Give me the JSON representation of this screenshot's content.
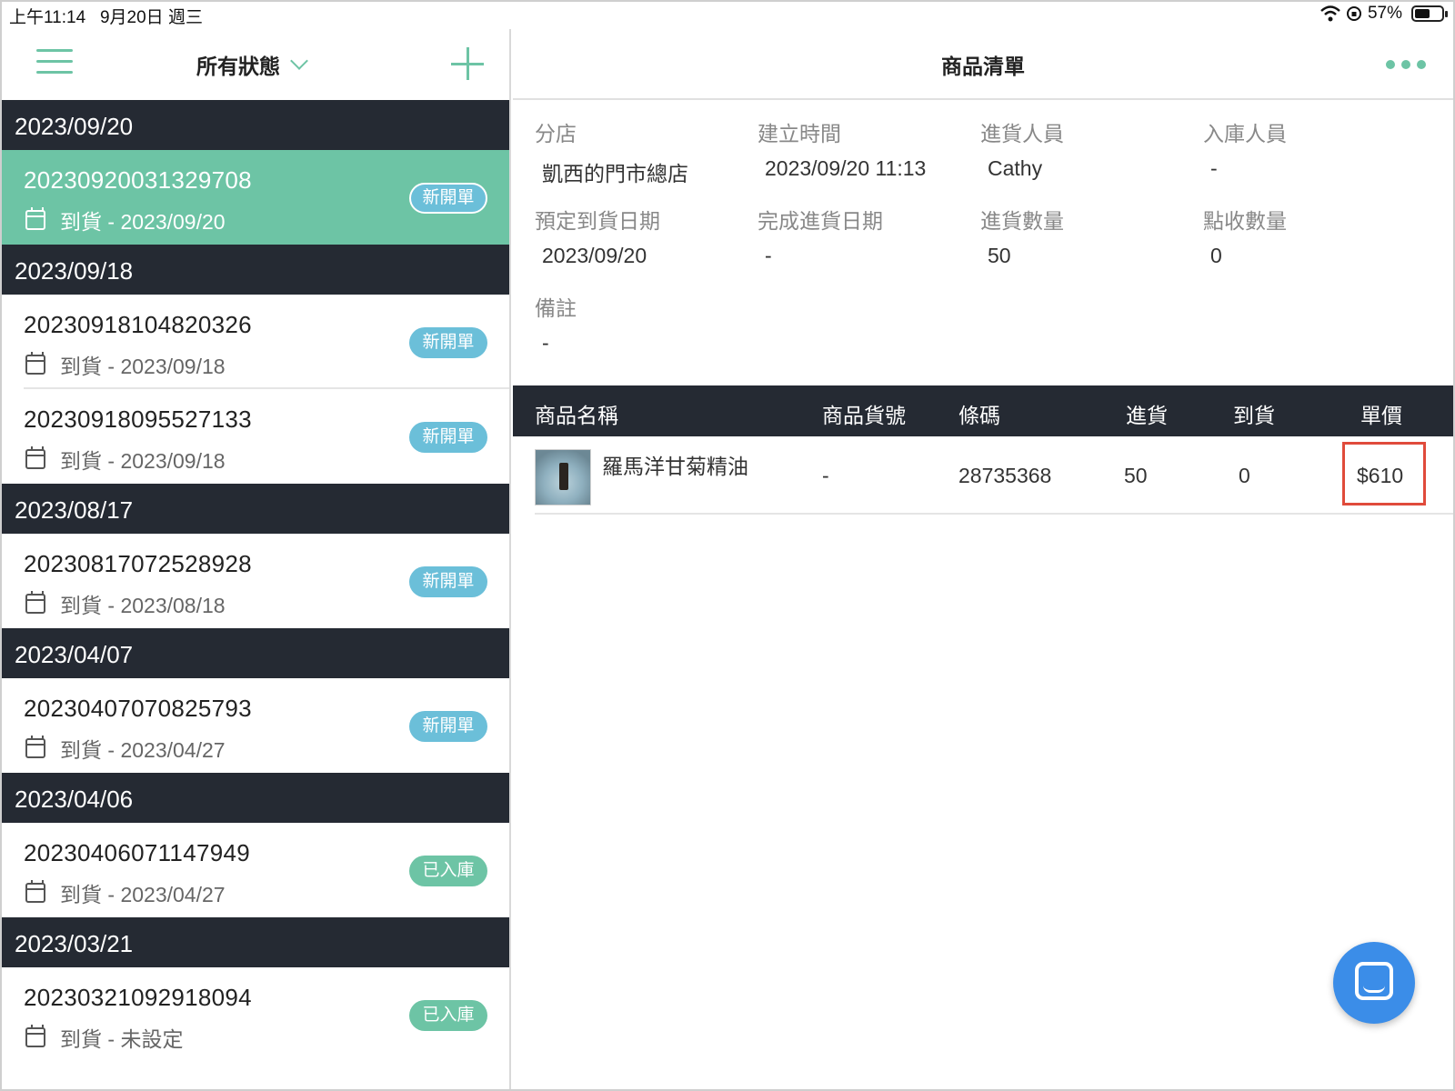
{
  "status_bar": {
    "time_date": "上午11:14   9月20日 週三",
    "battery": "57%",
    "battery_level": 0.57
  },
  "left_panel": {
    "filter_label": "所有狀態",
    "groups": [
      {
        "date": "2023/09/20",
        "orders": [
          {
            "id": "20230920031329708",
            "arrival": "到貨 - 2023/09/20",
            "status": "新開單",
            "kind": "new",
            "selected": true
          }
        ]
      },
      {
        "date": "2023/09/18",
        "orders": [
          {
            "id": "20230918104820326",
            "arrival": "到貨 - 2023/09/18",
            "status": "新開單",
            "kind": "new"
          },
          {
            "id": "20230918095527133",
            "arrival": "到貨 - 2023/09/18",
            "status": "新開單",
            "kind": "new"
          }
        ]
      },
      {
        "date": "2023/08/17",
        "orders": [
          {
            "id": "20230817072528928",
            "arrival": "到貨 - 2023/08/18",
            "status": "新開單",
            "kind": "new"
          }
        ]
      },
      {
        "date": "2023/04/07",
        "orders": [
          {
            "id": "20230407070825793",
            "arrival": "到貨 - 2023/04/27",
            "status": "新開單",
            "kind": "new"
          }
        ]
      },
      {
        "date": "2023/04/06",
        "orders": [
          {
            "id": "20230406071147949",
            "arrival": "到貨 - 2023/04/27",
            "status": "已入庫",
            "kind": "done"
          }
        ]
      },
      {
        "date": "2023/03/21",
        "orders": [
          {
            "id": "20230321092918094",
            "arrival": "到貨 - 未設定",
            "status": "已入庫",
            "kind": "done"
          }
        ]
      }
    ]
  },
  "right_panel": {
    "title": "商品清單",
    "info": {
      "branch_label": "分店",
      "branch": "凱西的門市總店",
      "created_label": "建立時間",
      "created": "2023/09/20 11:13",
      "purchaser_label": "進貨人員",
      "purchaser": "Cathy",
      "stocker_label": "入庫人員",
      "stocker": "-",
      "expected_label": "預定到貨日期",
      "expected": "2023/09/20",
      "completed_label": "完成進貨日期",
      "completed": "-",
      "qty_label": "進貨數量",
      "qty": "50",
      "checked_label": "點收數量",
      "checked": "0",
      "note_label": "備註",
      "note": "-"
    },
    "table": {
      "headers": {
        "name": "商品名稱",
        "sku": "商品貨號",
        "barcode": "條碼",
        "incoming": "進貨",
        "arrived": "到貨",
        "price": "單價"
      },
      "rows": [
        {
          "name": "羅馬洋甘菊精油",
          "sku": "-",
          "barcode": "28735368",
          "incoming": "50",
          "arrived": "0",
          "price": "$610"
        }
      ]
    }
  },
  "colors": {
    "accent": "#6dc4a5",
    "dark_header": "#252a33",
    "badge_new": "#6bbfd9",
    "highlight": "#e04b3b",
    "chat": "#3b8de8"
  }
}
